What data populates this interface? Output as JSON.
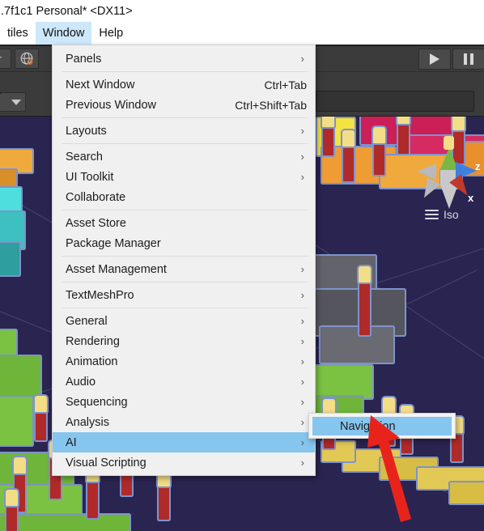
{
  "window": {
    "title": ".7f1c1 Personal* <DX11>"
  },
  "menubar": {
    "items": [
      {
        "label": "tiles",
        "active": false
      },
      {
        "label": "Window",
        "active": true
      },
      {
        "label": "Help",
        "active": false
      }
    ]
  },
  "toolbar": {
    "globe_icon": "globe-icon",
    "play_icon": "play-icon",
    "pause_icon": "pause-icon",
    "dropdown_icon": "chevron-down-icon"
  },
  "window_menu": {
    "groups": [
      {
        "items": [
          {
            "label": "Panels",
            "shortcut": "",
            "submenu": true,
            "highlighted": false
          }
        ]
      },
      {
        "items": [
          {
            "label": "Next Window",
            "shortcut": "Ctrl+Tab",
            "submenu": false,
            "highlighted": false
          },
          {
            "label": "Previous Window",
            "shortcut": "Ctrl+Shift+Tab",
            "submenu": false,
            "highlighted": false
          }
        ]
      },
      {
        "items": [
          {
            "label": "Layouts",
            "shortcut": "",
            "submenu": true,
            "highlighted": false
          }
        ]
      },
      {
        "items": [
          {
            "label": "Search",
            "shortcut": "",
            "submenu": true,
            "highlighted": false
          },
          {
            "label": "UI Toolkit",
            "shortcut": "",
            "submenu": true,
            "highlighted": false
          },
          {
            "label": "Collaborate",
            "shortcut": "",
            "submenu": false,
            "highlighted": false
          }
        ]
      },
      {
        "items": [
          {
            "label": "Asset Store",
            "shortcut": "",
            "submenu": false,
            "highlighted": false
          },
          {
            "label": "Package Manager",
            "shortcut": "",
            "submenu": false,
            "highlighted": false
          }
        ]
      },
      {
        "items": [
          {
            "label": "Asset Management",
            "shortcut": "",
            "submenu": true,
            "highlighted": false
          }
        ]
      },
      {
        "items": [
          {
            "label": "TextMeshPro",
            "shortcut": "",
            "submenu": true,
            "highlighted": false
          }
        ]
      },
      {
        "items": [
          {
            "label": "General",
            "shortcut": "",
            "submenu": true,
            "highlighted": false
          },
          {
            "label": "Rendering",
            "shortcut": "",
            "submenu": true,
            "highlighted": false
          },
          {
            "label": "Animation",
            "shortcut": "",
            "submenu": true,
            "highlighted": false
          },
          {
            "label": "Audio",
            "shortcut": "",
            "submenu": true,
            "highlighted": false
          },
          {
            "label": "Sequencing",
            "shortcut": "",
            "submenu": true,
            "highlighted": false
          },
          {
            "label": "Analysis",
            "shortcut": "",
            "submenu": true,
            "highlighted": false
          },
          {
            "label": "AI",
            "shortcut": "",
            "submenu": true,
            "highlighted": true
          },
          {
            "label": "Visual Scripting",
            "shortcut": "",
            "submenu": true,
            "highlighted": false
          }
        ]
      }
    ]
  },
  "submenu": {
    "items": [
      {
        "label": "Navigation",
        "highlighted": true
      }
    ]
  },
  "scene": {
    "view_mode": "Iso",
    "axis_labels": {
      "x": "x",
      "z": "z"
    }
  },
  "colors": {
    "menu_highlight": "#85c5ee",
    "menubar_highlight": "#cde8fa",
    "menu_background": "#f0f0f0",
    "annotation_arrow": "#e8231b",
    "scene_background": "#2a2450",
    "toolbar_background": "#3b3b3b"
  }
}
